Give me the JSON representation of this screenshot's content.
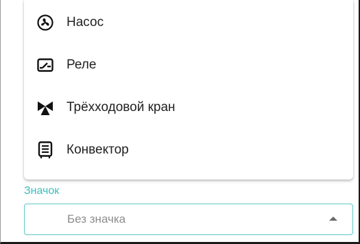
{
  "menu": {
    "items": [
      {
        "label": "Насос",
        "icon": "pump-fan-icon"
      },
      {
        "label": "Реле",
        "icon": "relay-switch-icon"
      },
      {
        "label": "Трёхходовой кран",
        "icon": "three-way-valve-icon"
      },
      {
        "label": "Конвектор",
        "icon": "convector-icon"
      }
    ]
  },
  "icon_field": {
    "label": "Значок",
    "value": "Без значка"
  },
  "colors": {
    "accent": "#3bbdbd",
    "field_border": "#5cc6c6",
    "text": "#212121",
    "placeholder": "#8c8c8c"
  }
}
